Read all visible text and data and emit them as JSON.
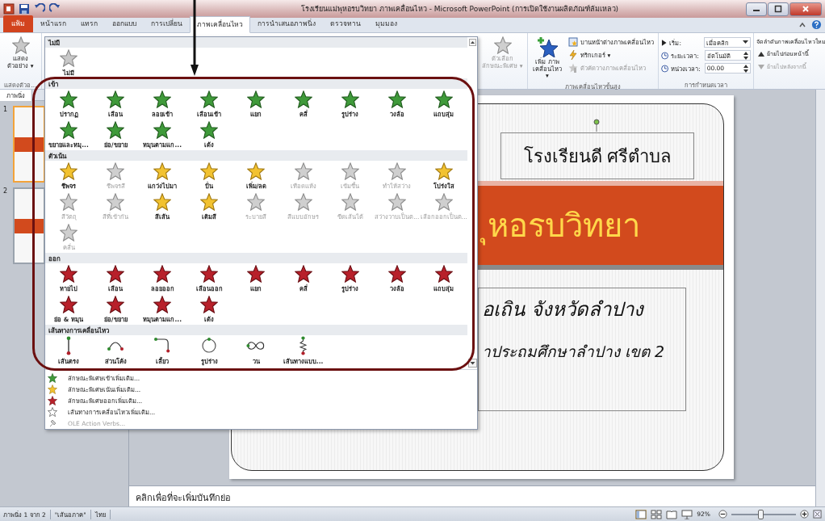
{
  "title_bar": {
    "title": "โรงเรียนแม่พุหอรบวิทยา ภาพเคลื่อนไหว - Microsoft PowerPoint (การเปิดใช้งานผลิตภัณฑ์ล้มเหลว)"
  },
  "ribbon_tabs": [
    {
      "label": "แฟ้ม",
      "selected": false,
      "kind": "file"
    },
    {
      "label": "หน้าแรก",
      "selected": false,
      "kind": "tab"
    },
    {
      "label": "แทรก",
      "selected": false,
      "kind": "tab"
    },
    {
      "label": "ออกแบบ",
      "selected": false,
      "kind": "tab"
    },
    {
      "label": "การเปลี่ยน",
      "selected": false,
      "kind": "tab"
    },
    {
      "label": "ภาพเคลื่อนไหว",
      "selected": true,
      "kind": "tab"
    },
    {
      "label": "การนำเสนอภาพนิ่ง",
      "selected": false,
      "kind": "tab"
    },
    {
      "label": "ตรวจทาน",
      "selected": false,
      "kind": "tab"
    },
    {
      "label": "มุมมอง",
      "selected": false,
      "kind": "tab"
    }
  ],
  "ribbon": {
    "preview": {
      "label": "แสดง ตัวอย่าง ▾",
      "group": "แสดงตัวอ..."
    },
    "effect_options": {
      "label": "ตัวเลือก ลักษณะพิเศษ ▾",
      "disabled": true
    },
    "add_animation": {
      "label": "เพิ่ม ภาพเคลื่อนไหว ▾"
    },
    "advanced_items": [
      {
        "label": "บานหน้าต่างภาพเคลื่อนไหว",
        "disabled": false,
        "kind": "pane"
      },
      {
        "label": "ทริกเกอร์ ▾",
        "disabled": false,
        "kind": "trigger"
      },
      {
        "label": "ตัวคัดวางภาพเคลื่อนไหว",
        "disabled": true,
        "kind": "painter"
      }
    ],
    "advanced_group": "ภาพเคลื่อนไหวขั้นสูง",
    "timing": [
      {
        "label": "เริ่ม:",
        "value": "เมื่อคลิก",
        "kind": "dropdown"
      },
      {
        "label": "ระยะเวลา:",
        "value": "อัตโนมัติ",
        "kind": "spinner"
      },
      {
        "label": "หน่วงเวลา:",
        "value": "00.00",
        "kind": "spinner"
      }
    ],
    "timing_group": "การกำหนดเวลา",
    "reorder": {
      "title": "จัดลำดับภาพเคลื่อนไหวใหม่",
      "items": [
        {
          "label": "ย้ายไปก่อนหน้านี้",
          "disabled": false
        },
        {
          "label": "ย้ายไปหลังจากนี้",
          "disabled": true
        }
      ]
    }
  },
  "gallery": {
    "sections": [
      {
        "kind": "none",
        "title": "ไม่มี",
        "items": [
          {
            "label": "ไม่มี",
            "disabled": false
          }
        ]
      },
      {
        "kind": "entrance",
        "title": "เข้า",
        "items": [
          {
            "label": "ปรากฏ",
            "disabled": false
          },
          {
            "label": "เลือน",
            "disabled": false
          },
          {
            "label": "ลอยเข้า",
            "disabled": false
          },
          {
            "label": "เลือนเข้า",
            "disabled": false
          },
          {
            "label": "แยก",
            "disabled": false
          },
          {
            "label": "คลี่",
            "disabled": false
          },
          {
            "label": "รูปร่าง",
            "disabled": false
          },
          {
            "label": "วงล้อ",
            "disabled": false
          },
          {
            "label": "แถบสุ่ม",
            "disabled": false
          },
          {
            "label": "ขยายและหมุ...",
            "disabled": false
          },
          {
            "label": "ย่อ/ขยาย",
            "disabled": false
          },
          {
            "label": "หมุนตามแก...",
            "disabled": false
          },
          {
            "label": "เด้ง",
            "disabled": false
          }
        ]
      },
      {
        "kind": "emphasis",
        "title": "ตัวเน้น",
        "items": [
          {
            "label": "ชีพจร",
            "disabled": false
          },
          {
            "label": "ชีพจรสี",
            "disabled": true
          },
          {
            "label": "แกว่งไปมา",
            "disabled": false
          },
          {
            "label": "ปั่น",
            "disabled": false
          },
          {
            "label": "เพิ่ม/ลด",
            "disabled": false
          },
          {
            "label": "เทือดแห้ง",
            "disabled": true
          },
          {
            "label": "เข้มขึ้น",
            "disabled": true
          },
          {
            "label": "ทำให้สว่าง",
            "disabled": true
          },
          {
            "label": "โปร่งใส",
            "disabled": false
          },
          {
            "label": "สีวัตถุ",
            "disabled": true
          },
          {
            "label": "สีที่เข้ากัน",
            "disabled": true
          },
          {
            "label": "สีเส้น",
            "disabled": false
          },
          {
            "label": "เติมสี",
            "disabled": false
          },
          {
            "label": "ระบายสี",
            "disabled": true
          },
          {
            "label": "สีแบบอักษร",
            "disabled": true
          },
          {
            "label": "ขีดเส้นใต้",
            "disabled": true
          },
          {
            "label": "สว่างวาบเป็นต...",
            "disabled": true
          },
          {
            "label": "เลือกออกเป็นต...",
            "disabled": true
          },
          {
            "label": "คลื่น",
            "disabled": true
          }
        ]
      },
      {
        "kind": "exit",
        "title": "ออก",
        "items": [
          {
            "label": "หายไป",
            "disabled": false
          },
          {
            "label": "เลือน",
            "disabled": false
          },
          {
            "label": "ลอยออก",
            "disabled": false
          },
          {
            "label": "เลือนออก",
            "disabled": false
          },
          {
            "label": "แยก",
            "disabled": false
          },
          {
            "label": "คลี่",
            "disabled": false
          },
          {
            "label": "รูปร่าง",
            "disabled": false
          },
          {
            "label": "วงล้อ",
            "disabled": false
          },
          {
            "label": "แถบสุ่ม",
            "disabled": false
          },
          {
            "label": "ย่อ & หมุน",
            "disabled": false
          },
          {
            "label": "ย่อ/ขยาย",
            "disabled": false
          },
          {
            "label": "หมุนตามแก...",
            "disabled": false
          },
          {
            "label": "เด้ง",
            "disabled": false
          }
        ]
      },
      {
        "kind": "path",
        "title": "เส้นทางการเคลื่อนไหว",
        "items": [
          {
            "label": "เส้นตรง",
            "disabled": false,
            "kind": "line"
          },
          {
            "label": "ส่วนโค้ง",
            "disabled": false,
            "kind": "arc"
          },
          {
            "label": "เลี้ยว",
            "disabled": false,
            "kind": "turn"
          },
          {
            "label": "รูปร่าง",
            "disabled": false,
            "kind": "circle"
          },
          {
            "label": "วน",
            "disabled": false,
            "kind": "loop"
          },
          {
            "label": "เส้นทางแบบ...",
            "disabled": false,
            "kind": "custom"
          }
        ]
      }
    ],
    "menu": [
      {
        "label": "ลักษณะพิเศษเข้าเพิ่มเติม...",
        "kind": "entrance",
        "disabled": false
      },
      {
        "label": "ลักษณะพิเศษเน้นเพิ่มเติม...",
        "kind": "emphasis",
        "disabled": false
      },
      {
        "label": "ลักษณะพิเศษออกเพิ่มเติม...",
        "kind": "exit",
        "disabled": false
      },
      {
        "label": "เส้นทางการเคลื่อนไหวเพิ่มเติม...",
        "kind": "path",
        "disabled": false
      },
      {
        "label": "OLE Action Verbs...",
        "kind": "ole",
        "disabled": true
      }
    ]
  },
  "slides_pane": {
    "tab": "ภาพนิ่ง",
    "thumbnails": [
      {
        "number": "1",
        "selected": true
      },
      {
        "number": "2",
        "selected": false
      }
    ]
  },
  "slide": {
    "title": "โรงเรียนดี ศรีตำบล",
    "banner": "ุหอรบวิทยา",
    "lines": [
      "อเถิน จังหวัดลำปาง",
      "าประถมศึกษาลำปาง เขต 2"
    ]
  },
  "notes": {
    "prompt": "คลิกเพื่อที่จะเพิ่มบันทึกย่อ"
  },
  "status_bar": {
    "items": [
      "ภาพนิ่ง 1 จาก 2",
      "\"เส้นอภาค\"",
      "ไทย"
    ],
    "zoom": "92%",
    "zoom_slider": {
      "level": 0.45
    }
  }
}
